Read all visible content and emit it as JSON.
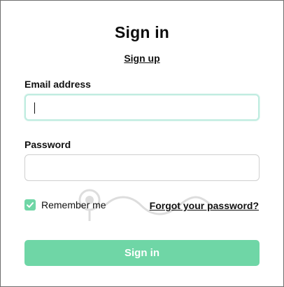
{
  "form": {
    "title": "Sign in",
    "signup_link": "Sign up",
    "email_label": "Email address",
    "email_value": "",
    "password_label": "Password",
    "password_value": "",
    "remember_label": "Remember me",
    "remember_checked": true,
    "forgot_link": "Forgot your password?",
    "submit_label": "Sign in"
  },
  "colors": {
    "accent": "#6fd6a6",
    "focus_border": "#bfece0",
    "text": "#111111",
    "border": "#cfcfcf"
  },
  "icons": {
    "checkbox": "checkmark-icon",
    "watermark": "quantrimang-logo"
  }
}
